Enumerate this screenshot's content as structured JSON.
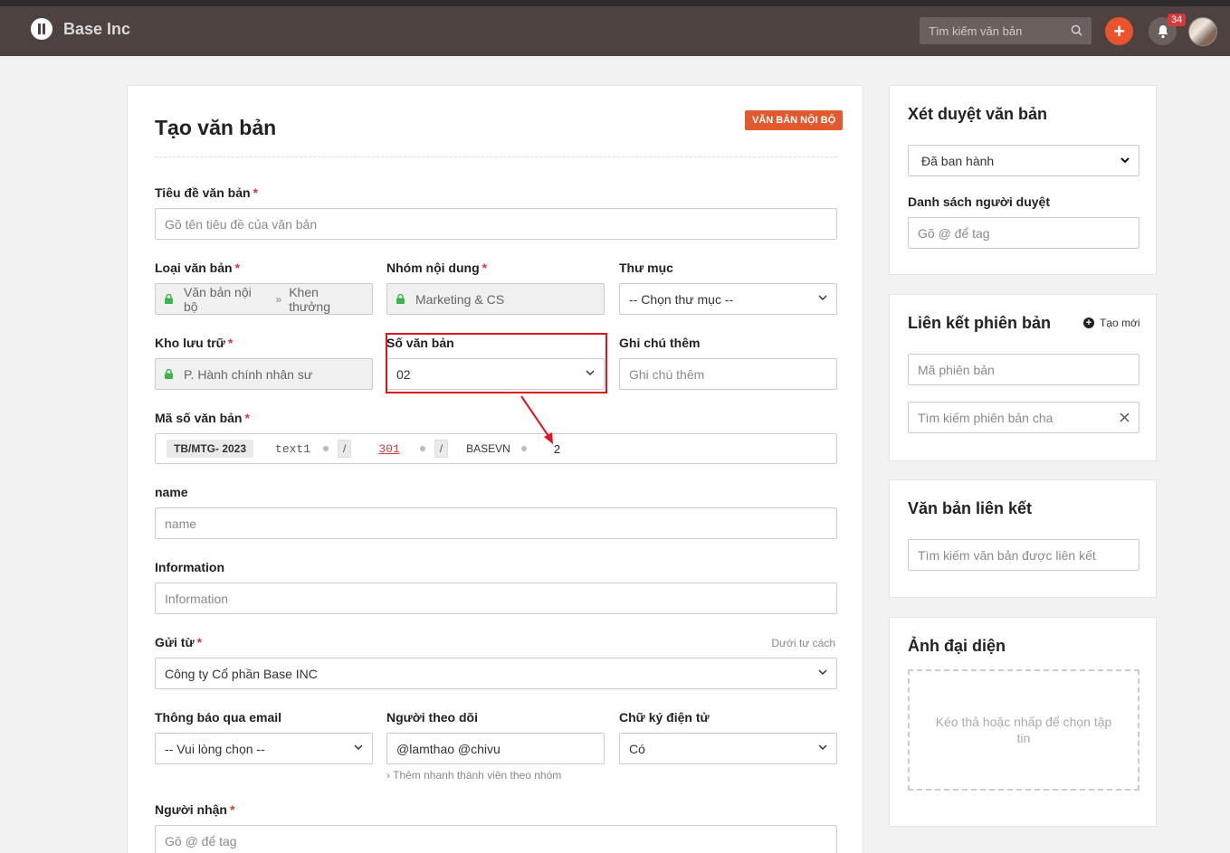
{
  "topbar": {
    "brand": "Base Inc",
    "search_placeholder": "Tìm kiếm văn bản",
    "add_label": "+",
    "notification_count": "34"
  },
  "form": {
    "title": "Tạo văn bản",
    "tag": "VĂN BẢN NỘI BỘ",
    "doc_title": {
      "label": "Tiêu đề văn bản",
      "required": "*",
      "placeholder": "Gõ tên tiêu đề của văn bản"
    },
    "doc_type": {
      "label": "Loại văn bản",
      "required": "*",
      "value_1": "Văn bản nội bộ",
      "separator": "»",
      "value_2": "Khen thưởng"
    },
    "content_group": {
      "label": "Nhóm nội dung",
      "required": "*",
      "value": "Marketing & CS"
    },
    "folder": {
      "label": "Thư mục",
      "value": "-- Chọn thư mục --"
    },
    "storage": {
      "label": "Kho lưu trữ",
      "required": "*",
      "value": "P. Hành chính nhân sư"
    },
    "doc_number": {
      "label": "Số văn bản",
      "value": "02"
    },
    "note": {
      "label": "Ghi chú thêm",
      "placeholder": "Ghi chú thêm"
    },
    "doc_code": {
      "label": "Mã số văn bản",
      "required": "*",
      "prefix": "TB/MTG- 2023",
      "text1": "text1",
      "slash_1": "/",
      "num": "301",
      "slash_2": "/",
      "company": "BASEVN",
      "seq": "2"
    },
    "name": {
      "label": "name",
      "placeholder": "name"
    },
    "information": {
      "label": "Information",
      "placeholder": "Information"
    },
    "sent_from": {
      "label": "Gửi từ",
      "required": "*",
      "hint": "Dưới tư cách",
      "value": "Công ty Cổ phần Base INC"
    },
    "email_notify": {
      "label": "Thông báo qua email",
      "value": "-- Vui lòng chọn --"
    },
    "followers": {
      "label": "Người theo dõi",
      "value": "@lamthao @chivu",
      "hint": "› Thêm nhanh thành viên theo nhóm"
    },
    "esign": {
      "label": "Chữ ký điện tử",
      "value": "Có"
    },
    "recipients": {
      "label": "Người nhận",
      "required": "*",
      "placeholder": "Gõ @ để tag"
    }
  },
  "sidebar": {
    "review": {
      "title": "Xét duyệt văn bản",
      "status": "Đã ban hành",
      "approvers_label": "Danh sách người duyệt",
      "approvers_placeholder": "Gõ @ để tag"
    },
    "version_link": {
      "title": "Liên kết phiên bản",
      "create_label": "Tạo mới",
      "code_placeholder": "Mã phiên bản",
      "parent_placeholder": "Tìm kiếm phiên bản cha"
    },
    "linked_docs": {
      "title": "Văn bản liên kết",
      "search_placeholder": "Tìm kiếm văn bản được liên kết"
    },
    "cover": {
      "title": "Ảnh đại diện",
      "drop_text": "Kéo thả hoặc nhấp để chọn tập tin"
    }
  },
  "colors": {
    "topbar": "#4d4240",
    "accent": "#e3592f",
    "required": "#d43a3a",
    "highlight": "#e0141b"
  }
}
